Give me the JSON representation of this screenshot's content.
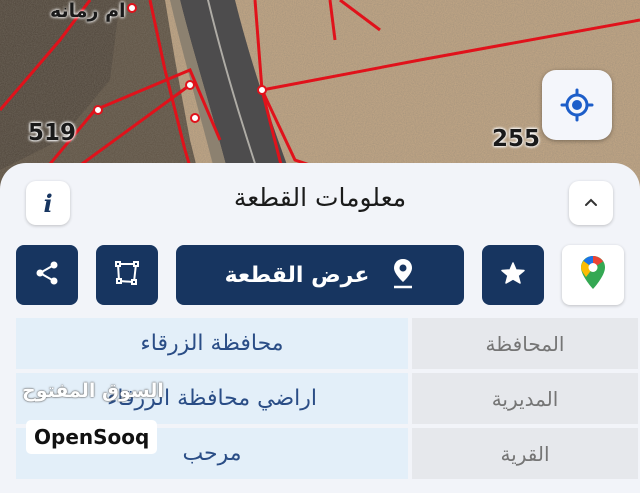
{
  "map": {
    "place_label": "ام رمانه",
    "parcel_left": "519",
    "parcel_right": "255",
    "locate_icon": "crosshair-icon"
  },
  "sheet": {
    "title": "معلومات القطعة",
    "info_icon_text": "i",
    "collapse_icon": "chevron-up-icon"
  },
  "actions": {
    "view_parcel_label": "عرض القطعة",
    "view_parcel_icon": "location-pin-icon",
    "share_icon": "share-icon",
    "boundary_icon": "polygon-icon",
    "favorite_icon": "star-icon",
    "maps_icon": "google-maps-icon"
  },
  "info_rows": [
    {
      "label": "المحافظة",
      "value": "محافظة الزرقاء"
    },
    {
      "label": "المديرية",
      "value": "اراضي محافظة الزرقاء"
    },
    {
      "label": "القرية",
      "value": "مرحب"
    }
  ],
  "watermark": {
    "arabic": "السوق المفتوح",
    "latin": "OpenSooq"
  },
  "colors": {
    "primary_navy": "#173560",
    "value_text_blue": "#2a4d86",
    "parcel_line_red": "#e0121b",
    "sheet_bg": "#f2f4f9"
  }
}
